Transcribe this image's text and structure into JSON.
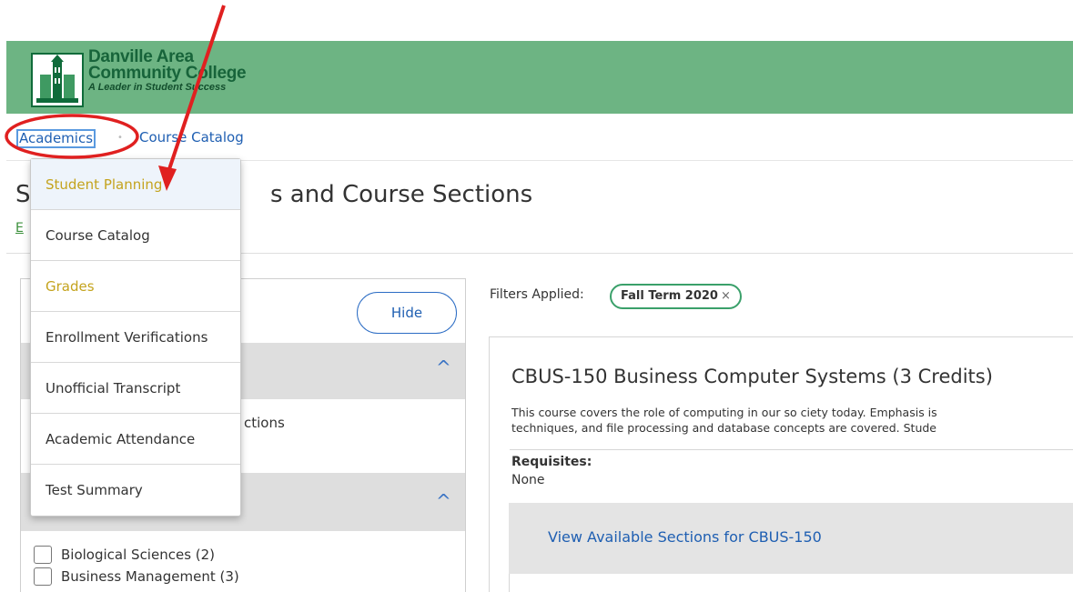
{
  "header": {
    "logo_line1": "Danville Area",
    "logo_line2": "Community College",
    "logo_tagline": "A Leader in Student Success"
  },
  "breadcrumb": {
    "academics": "Academics",
    "separator": "•",
    "course_catalog": "Course Catalog"
  },
  "page": {
    "title_first_letter": "S",
    "title_rest": "s and Course Sections",
    "link_letter": "E"
  },
  "dropdown": {
    "items": [
      {
        "label": "Student Planning",
        "color": "#c4a31d"
      },
      {
        "label": "Course Catalog",
        "color": "#333333"
      },
      {
        "label": "Grades",
        "color": "#c4a31d"
      },
      {
        "label": "Enrollment Verifications",
        "color": "#333333"
      },
      {
        "label": "Unofficial Transcript",
        "color": "#333333"
      },
      {
        "label": "Academic Attendance",
        "color": "#333333"
      },
      {
        "label": "Test Summary",
        "color": "#333333"
      }
    ]
  },
  "left_panel": {
    "hide_label": "Hide",
    "group1_chevron": "^",
    "group2_chevron": "^",
    "sections_partial": "ctions",
    "checkboxes": [
      {
        "label": "Biological Sciences (2)",
        "checked": false
      },
      {
        "label": "Business Management (3)",
        "checked": false
      }
    ]
  },
  "filters": {
    "label": "Filters Applied:",
    "chip": "Fall Term 2020",
    "chip_close": "×"
  },
  "course": {
    "title": "CBUS-150 Business Computer Systems (3 Credits)",
    "desc_line1": "This course covers the role of computing in our so ciety today. Emphasis is",
    "desc_line2": "techniques, and file processing and database concepts are covered. Stude",
    "requisites_label": "Requisites:",
    "requisites_value": "None",
    "sections_link": "View Available Sections for CBUS-150"
  },
  "colors": {
    "banner": "#6db483",
    "link": "#1f5fb2",
    "annotation": "#e02020",
    "menu_highlight": "#c4a31d"
  }
}
